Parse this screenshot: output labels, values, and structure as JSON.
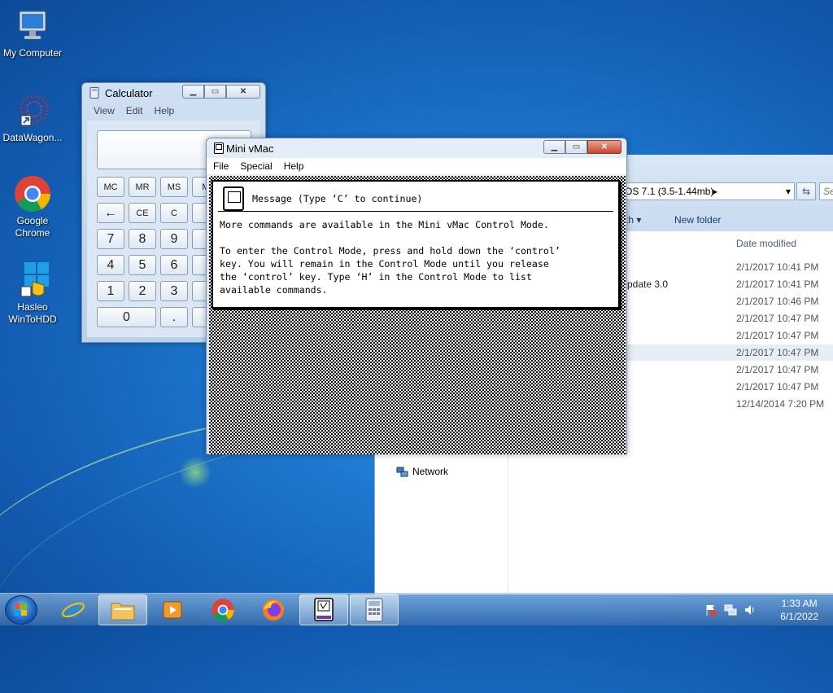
{
  "desktop": {
    "icons": [
      {
        "label": "My Computer",
        "icon": "computer-icon"
      },
      {
        "label": "DataWagon...",
        "icon": "datawagon-icon"
      },
      {
        "label": "Google Chrome",
        "icon": "chrome-icon"
      },
      {
        "label": "Hasleo WinToHDD",
        "icon": "wintohdd-icon"
      }
    ]
  },
  "calculator": {
    "title": "Calculator",
    "menu": [
      "View",
      "Edit",
      "Help"
    ],
    "keys": {
      "mc": "MC",
      "mr": "MR",
      "ms": "MS",
      "mplus": "M",
      "back": "←",
      "ce": "CE",
      "c": "C",
      "k7": "7",
      "k8": "8",
      "k9": "9",
      "k4": "4",
      "k5": "5",
      "k6": "6",
      "k1": "1",
      "k2": "2",
      "k3": "3",
      "k0": "0",
      "dot": "."
    }
  },
  "explorer": {
    "address": "OS 7.1 (3.5-1.44mb)",
    "search_placeholder": "Se",
    "toolbar": {
      "share_with": "th ▾",
      "new_folder": "New folder"
    },
    "column_header": "Date modified",
    "partial_name": "pdate 3.0",
    "nav_network": "Network",
    "dates": [
      "2/1/2017 10:41 PM",
      "2/1/2017 10:41 PM",
      "2/1/2017 10:46 PM",
      "2/1/2017 10:47 PM",
      "2/1/2017 10:47 PM",
      "2/1/2017 10:47 PM",
      "2/1/2017 10:47 PM",
      "2/1/2017 10:47 PM",
      "12/14/2014 7:20 PM"
    ]
  },
  "vmac": {
    "title": "Mini vMac",
    "menu": [
      "File",
      "Special",
      "Help"
    ],
    "message_title": "Message (Type ‘C’ to continue)",
    "lines": [
      "More commands are available in the Mini vMac Control Mode.",
      "",
      "To enter the Control Mode, press and hold down the ‘control’",
      "key. You will remain in the Control Mode until you release",
      "the ‘control’ key. Type ‘H’ in the Control Mode to list",
      "available commands."
    ]
  },
  "taskbar": {
    "clock_time": "1:33 AM",
    "clock_date": "6/1/2022"
  }
}
